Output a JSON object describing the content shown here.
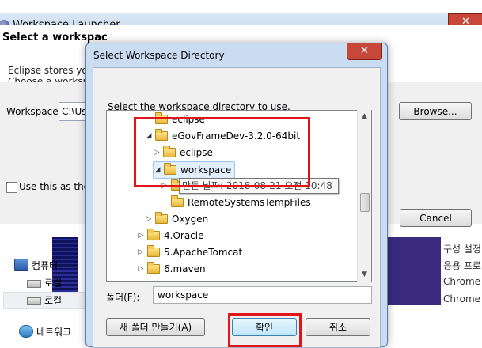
{
  "explorer": {
    "items": [
      {
        "label": "컴퓨터"
      },
      {
        "label": "로컬"
      },
      {
        "label": "로컬"
      },
      {
        "label": "네트워크"
      }
    ],
    "side_texts": [
      "구성 설정",
      "응용 프로",
      "Chrome H",
      "Chrome H"
    ]
  },
  "launcher": {
    "title": "Workspace Launcher",
    "close_glyph": "✕",
    "heading": "Select a workspac",
    "desc_line1": "Eclipse stores your",
    "desc_line2": "Choose a workspac",
    "workspace_label": "Workspace:",
    "workspace_value": "C:\\Us",
    "use_default_label": "Use this as the d",
    "browse_label": "Browse...",
    "cancel_label": "Cancel"
  },
  "dialog": {
    "title": "Select Workspace Directory",
    "close_glyph": "✕",
    "instruction": "Select the workspace directory to use.",
    "tree": [
      {
        "label": "eclipse"
      },
      {
        "label": "eGovFrameDev-3.2.0-64bit"
      },
      {
        "label": "eclipse"
      },
      {
        "label": "workspace"
      },
      {
        "label": "RemoteSystemsTempFiles"
      },
      {
        "label": "Oxygen"
      },
      {
        "label": "4.Oracle"
      },
      {
        "label": "5.ApacheTomcat"
      },
      {
        "label": "6.maven"
      }
    ],
    "tooltip": "만든 날짜: 2018-08-21 오전 10:48",
    "folder_label": "폴더(F):",
    "folder_value": "workspace",
    "new_folder_label": "새 폴더 만들기(A)",
    "ok_label": "확인",
    "cancel_label": "취소"
  },
  "colors": {
    "highlight_box": "#e2141a",
    "selection": "#e2effc",
    "title_close": "#c7473a"
  }
}
